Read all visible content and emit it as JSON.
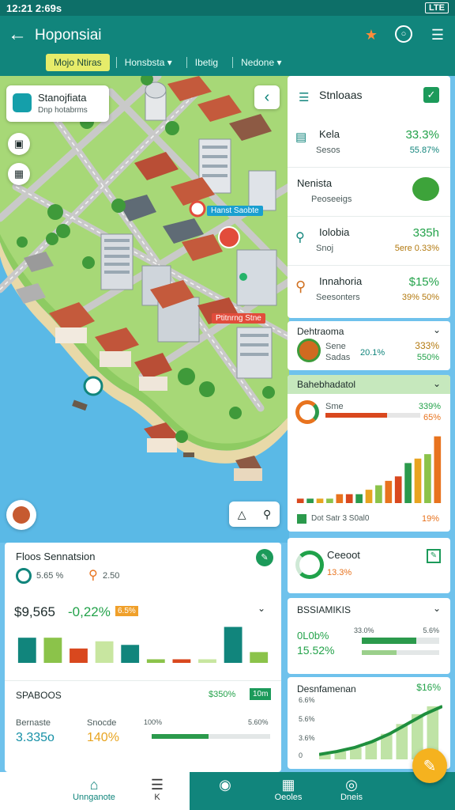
{
  "statusbar": {
    "time": "12:21 2:69s",
    "battery": "LTE"
  },
  "appbar": {
    "title": "Hoponsiai",
    "back_icon": "arrow-left-icon",
    "icons": [
      "star-pin-icon",
      "chat-icon",
      "menu-icon"
    ]
  },
  "filters": [
    {
      "label": "Mojo Ntiras",
      "active": true
    },
    {
      "label": "Honsbsta ▾",
      "active": false
    },
    {
      "label": "Ibetig",
      "active": false
    },
    {
      "label": "Nedone ▾",
      "active": false
    }
  ],
  "map": {
    "info_card": {
      "title": "Stanojfiata",
      "subtitle": "Dnp hotabrms"
    },
    "pin_labels": [
      "Hanst Saobte",
      "Ptitnrng Stne"
    ]
  },
  "right_panel": {
    "header": "Stnloaas",
    "items": [
      {
        "name": "Kela",
        "sub": "Sesos",
        "value": "33.3%",
        "pct": "55.87%"
      },
      {
        "name": "Nenista",
        "sub": "Peoseeigs",
        "value": "",
        "pct": ""
      },
      {
        "name": "Iolobia",
        "sub": "Snoj",
        "value": "335h",
        "pct": "5ere 0.33%"
      },
      {
        "name": "Innahoria",
        "sub": "Seesonters",
        "value": "$15%",
        "pct": "39% 50%"
      }
    ],
    "detail": {
      "title": "Dehtraoma",
      "a": "Sene",
      "b": "Sadas",
      "c": "20.1%",
      "value": "333%",
      "pct": "550%"
    },
    "chart_section": {
      "title": "Bahebhadatol",
      "row_label": "Sme",
      "row_value": "339%",
      "row_pct": "65%",
      "footer_a": "Dot Satr 3 S0al0",
      "footer_pct": "19%"
    },
    "report": {
      "title": "Ceeoot",
      "value": "13.3%"
    },
    "stats": {
      "title": "BSSIAMIKIS",
      "big": "0L0b%",
      "big2": "15.52%",
      "scale_a": "33.0%",
      "scale_b": "5.6%"
    },
    "growth": {
      "title": "Desnfamenan",
      "value": "$16%",
      "axis": [
        "6.6%",
        "5.6%",
        "3.6%",
        "0"
      ]
    }
  },
  "left_panel": {
    "title": "Floos Sennatsion",
    "stat_a": "5.65 %",
    "stat_b": "2.50",
    "big_value": "$9,565",
    "change": "-0,22%",
    "badge": "6.5%",
    "section2": "SPABOOS",
    "section2_value": "$350%",
    "section2_badge": "10m",
    "bottom_a_label": "Bernaste",
    "bottom_a_value": "3.335o",
    "bottom_b_label": "Snocde",
    "bottom_b_value": "140%",
    "axis_a": "100%",
    "axis_b": "5.60%"
  },
  "bottom_nav": [
    {
      "label": "Unnganote",
      "icon": "home-icon"
    },
    {
      "label": "K",
      "icon": "menu-icon"
    },
    {
      "label": "",
      "icon": "globe-icon"
    },
    {
      "label": "Oeoles",
      "icon": "building-icon"
    },
    {
      "label": "Dneis",
      "icon": "gauge-icon"
    }
  ],
  "colors": {
    "primary": "#11857c",
    "green": "#23a24a",
    "orange": "#e8731e",
    "water": "#5ab9e6"
  },
  "chart_data": [
    {
      "type": "bar",
      "title": "Bahebhadatol",
      "categories": [
        "a",
        "b",
        "c",
        "d",
        "e",
        "f",
        "g",
        "h",
        "i",
        "j",
        "k",
        "l",
        "m",
        "n",
        "o"
      ],
      "values": [
        1,
        1,
        1,
        1,
        2,
        2,
        2,
        3,
        4,
        5,
        6,
        9,
        10,
        11,
        15
      ],
      "ylim": [
        0,
        16
      ]
    },
    {
      "type": "bar",
      "title": "Floos Sennatsion",
      "categories": [
        "1",
        "2",
        "3",
        "4",
        "5",
        "6",
        "7",
        "8",
        "9",
        "10"
      ],
      "values": [
        7,
        7,
        4,
        6,
        5,
        1,
        1,
        1,
        10,
        3
      ],
      "ylim": [
        0,
        11
      ]
    },
    {
      "type": "area",
      "title": "Desnfamenan",
      "x": [
        1,
        2,
        3,
        4,
        5,
        6,
        7,
        8
      ],
      "values": [
        0.5,
        0.8,
        1.2,
        1.8,
        2.6,
        3.6,
        4.6,
        5.4
      ],
      "ylim": [
        0,
        6.6
      ]
    }
  ]
}
